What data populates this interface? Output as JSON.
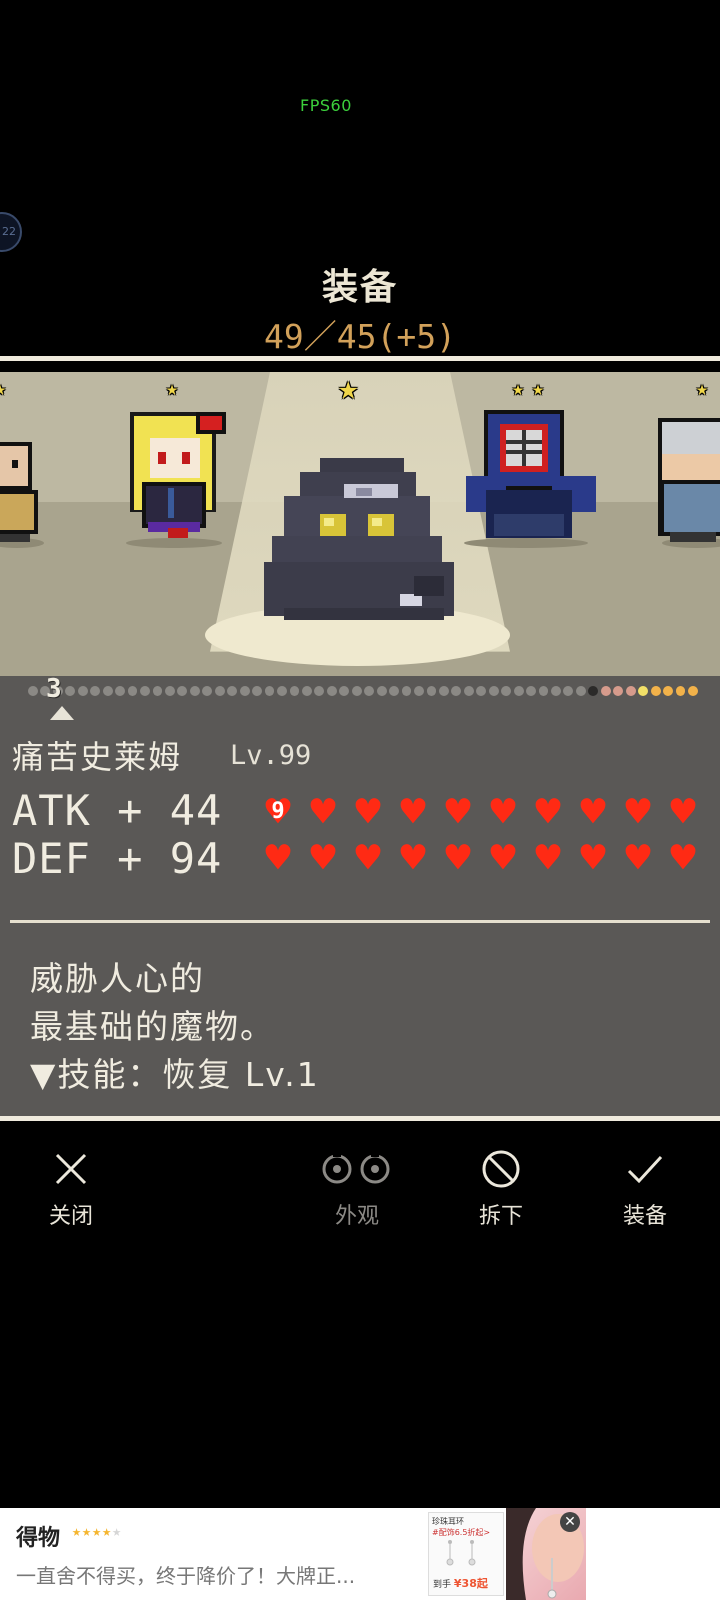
{
  "overlay": {
    "fps_label": "FPS60",
    "side_bubble": "22"
  },
  "header": {
    "title": "装备",
    "count": "49／45(+5)"
  },
  "roster": {
    "selected_index": 2,
    "characters": [
      {
        "name": "left-edge-character",
        "stars": 1
      },
      {
        "name": "blonde-girl",
        "stars": 1
      },
      {
        "name": "dark-slime",
        "stars": 1
      },
      {
        "name": "kendo-armor",
        "stars": 2
      },
      {
        "name": "right-edge-character",
        "stars": 1
      }
    ]
  },
  "pager": {
    "current": "3",
    "total_dots": 54,
    "dark_dot": 45,
    "pink_dots": [
      46,
      47,
      48
    ],
    "yellow_dot": 49,
    "orange_dots": [
      50,
      51,
      52,
      53
    ]
  },
  "character": {
    "name": "痛苦史莱姆",
    "level": "Lv.99",
    "atk_label": "ATK + 44",
    "def_label": "DEF + 94",
    "atk_hearts": 10,
    "def_hearts": 10,
    "atk_badge": "9"
  },
  "description": {
    "line1": "威胁人心的",
    "line2": "最基础的魔物。",
    "line3": "▼技能：恢复 Lv.1"
  },
  "actions": {
    "close": "关闭",
    "appearance": "外观",
    "unequip": "拆下",
    "equip": "装备"
  },
  "ad": {
    "brand": "得物",
    "rating": 4,
    "text": "一直舍不得买，终于降价了！大牌正...",
    "card_title": "珍珠耳环",
    "card_tag": "#配饰6.5折起>",
    "card_price_label": "到手",
    "card_price": "¥38起"
  },
  "colors": {
    "heart": "#ff2a14",
    "count": "#d2a15a",
    "fps": "#3ccf3c",
    "panel": "#5a5856",
    "stage": "#b6b19b"
  }
}
